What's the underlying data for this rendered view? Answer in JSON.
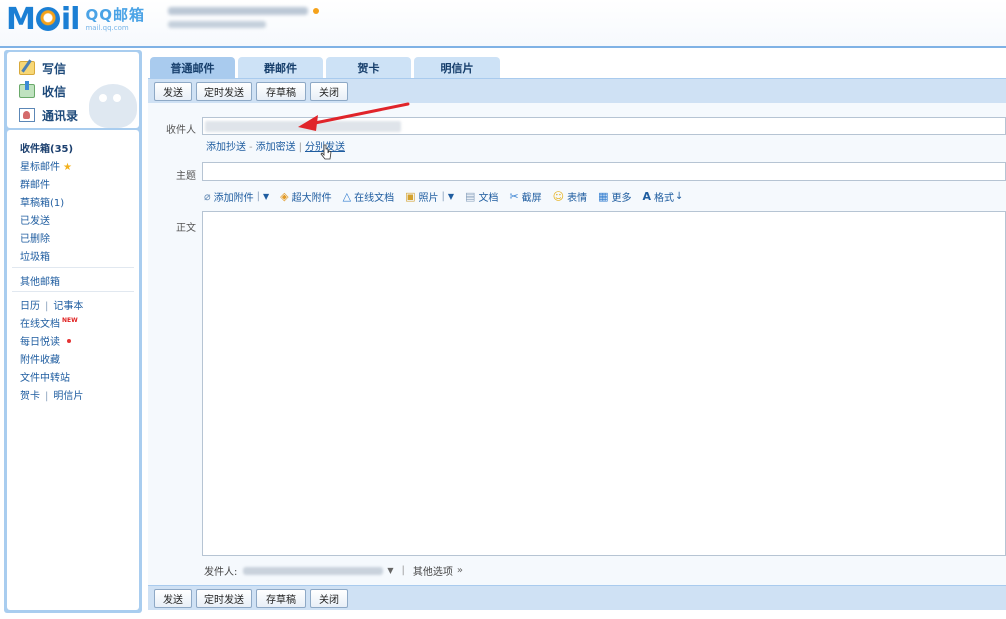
{
  "header": {
    "logo_text_left": "M",
    "logo_text_right": "il",
    "logo_qq": "QQ邮箱",
    "logo_domain": "mail.qq.com"
  },
  "sidebar": {
    "write": "写信",
    "inbox": "收信",
    "contacts": "通讯录",
    "folders": {
      "inbox": "收件箱(35)",
      "starred": "星标邮件",
      "group": "群邮件",
      "drafts": "草稿箱(1)",
      "sent": "已发送",
      "deleted": "已删除",
      "spam": "垃圾箱",
      "other_mailbox": "其他邮箱",
      "calendar": "日历",
      "notebook": "记事本",
      "online_docs": "在线文档",
      "new_badge": "NEW",
      "daily_read": "每日悦读",
      "attachments": "附件收藏",
      "file_transfer": "文件中转站",
      "greeting_card": "贺卡",
      "postcard": "明信片"
    }
  },
  "tabs": [
    {
      "label": "普通邮件"
    },
    {
      "label": "群邮件"
    },
    {
      "label": "贺卡"
    },
    {
      "label": "明信片"
    }
  ],
  "toolbar": {
    "send": "发送",
    "scheduled": "定时发送",
    "save_draft": "存草稿",
    "close": "关闭"
  },
  "compose": {
    "to_label": "收件人",
    "add_cc": "添加抄送",
    "sep1": "-",
    "add_bcc": "添加密送",
    "sep2": "|",
    "separate_send": "分别发送",
    "subject_label": "主题",
    "body_label": "正文",
    "attach_tools": [
      {
        "label": "添加附件",
        "icon": "paperclip-icon"
      },
      {
        "label": "超大附件",
        "icon": "big-attachment-icon"
      },
      {
        "label": "在线文档",
        "icon": "online-doc-icon"
      },
      {
        "label": "照片",
        "icon": "photo-icon"
      },
      {
        "label": "文档",
        "icon": "document-icon"
      },
      {
        "label": "截屏",
        "icon": "screenshot-icon"
      },
      {
        "label": "表情",
        "icon": "emoji-icon"
      },
      {
        "label": "更多",
        "icon": "more-icon"
      },
      {
        "label": "格式",
        "icon": "format-icon"
      }
    ],
    "from_label": "发件人:",
    "other_options": "其他选项"
  }
}
